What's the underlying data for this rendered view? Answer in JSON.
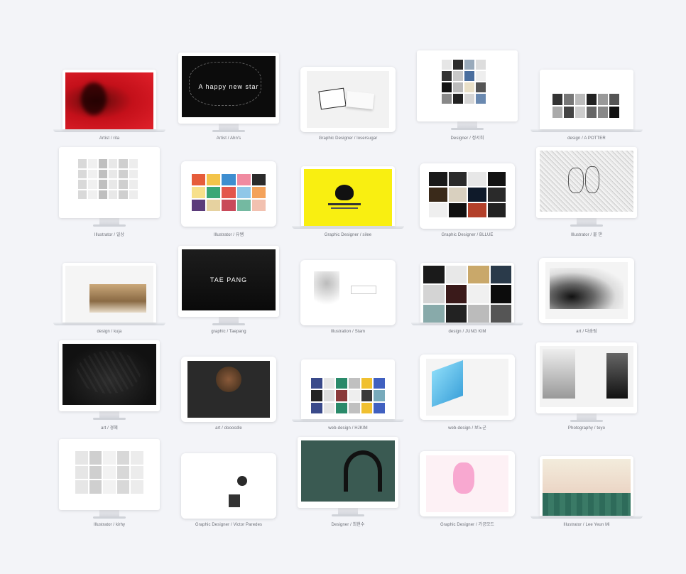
{
  "items": [
    {
      "caption": "Artist / rita",
      "device": "laptop",
      "theme": "red"
    },
    {
      "caption": "Artist / Ahn's",
      "device": "imac",
      "theme": "black-hands",
      "screen_text": "A happy new star"
    },
    {
      "caption": "Graphic Designer / losersugar",
      "device": "tablet",
      "theme": "cards"
    },
    {
      "caption": "Designer / 정서희",
      "device": "imac",
      "theme": "gallery"
    },
    {
      "caption": "design / A POTTER",
      "device": "laptop",
      "theme": "photo-grid"
    },
    {
      "caption": "Illustrator / 일상",
      "device": "imac",
      "theme": "sketches"
    },
    {
      "caption": "Illustrator / 유쌤",
      "device": "tablet",
      "theme": "colorful"
    },
    {
      "caption": "Graphic Designer / silee",
      "device": "laptop",
      "theme": "yellow"
    },
    {
      "caption": "Graphic Designer / BLLUE",
      "device": "tablet",
      "theme": "dark-grid"
    },
    {
      "caption": "Illustrator / 물 댄",
      "device": "imac",
      "theme": "pencil"
    },
    {
      "caption": "design / kuja",
      "device": "laptop",
      "theme": "interior"
    },
    {
      "caption": "graphic / Taepang",
      "device": "imac",
      "theme": "dark-wall",
      "screen_text": "TAE PANG"
    },
    {
      "caption": "Illustration / Stam",
      "device": "tablet",
      "theme": "love"
    },
    {
      "caption": "design / JUNG KIM",
      "device": "laptop",
      "theme": "collage"
    },
    {
      "caption": "art / 다솜림",
      "device": "tablet",
      "theme": "ink"
    },
    {
      "caption": "art / 경혜",
      "device": "imac",
      "theme": "leaf"
    },
    {
      "caption": "art / dooocdle",
      "device": "tablet",
      "theme": "dark-circle"
    },
    {
      "caption": "web-design / HJKIM",
      "device": "laptop",
      "theme": "web-grid"
    },
    {
      "caption": "web-design / 보노군",
      "device": "tablet",
      "theme": "stack"
    },
    {
      "caption": "Photography / teyo",
      "device": "imac",
      "theme": "portrait"
    },
    {
      "caption": "Illustrator / kirhy",
      "device": "imac",
      "theme": "doodles"
    },
    {
      "caption": "Graphic Designer / Victor Paredes",
      "device": "tablet",
      "theme": "minimal"
    },
    {
      "caption": "Designer / 최현수",
      "device": "imac",
      "theme": "headphones"
    },
    {
      "caption": "Graphic Designer / 가공모드",
      "device": "tablet",
      "theme": "pink-girl"
    },
    {
      "caption": "Illustrator / Lee Yeun Mi",
      "device": "laptop",
      "theme": "forest"
    }
  ]
}
